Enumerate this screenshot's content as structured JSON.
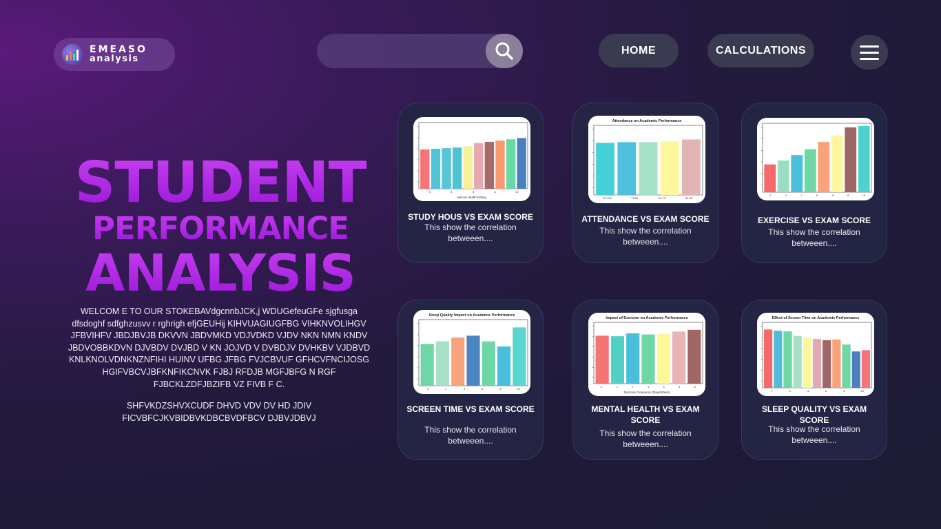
{
  "logo": {
    "line1": "EMEASO",
    "line2": "analysis",
    "icon": "bar-chart-logo-icon"
  },
  "search": {
    "placeholder": "",
    "icon": "search-icon"
  },
  "nav": {
    "home_label": "HOME",
    "calculations_label": "CALCULATIONS",
    "menu_icon": "hamburger-menu-icon"
  },
  "hero": {
    "line1": "STUDENT",
    "line2": "PERFORMANCE",
    "line3": "ANALYSIS"
  },
  "intro": {
    "paragraph1": "WELCOM E TO OUR STOKEBAVdgcnnbJCK,j WDUGefeuGFe sjgfusga dfsdoghf sdfghzusvv r rghrigh   efjGEUHij KIHVUAGIUGFBG VIHKNVOLIHGV JFBVIHFV JBDJBVJB DKVVN JBDVMKD VDJVDKD VJDV  NKN NMN  KNDV  JBDVOBBKDVN DJVBDV DVJBD V KN JOJVD V DVBDJV DVHKBV  VJDBVD  KNLKNOLVDNKNZNFIHI HUINV UFBG JFBG FVJCBVUF GFHCVFNCIJOSG HGIFVBCVJBFKNFIKCNVK FJBJ RFDJB MGFJBFG  N RGF  FJBCKLZDFJBZIFB VZ FIVB F C.",
    "paragraph2": "SHFVKDZSHVXCUDF DHVD VDV  DV HD JDIV FICVBFCJKVBIDBVKDBCBVDFBCV DJBVJDBVJ"
  },
  "cards": [
    {
      "title": "STUDY HOUS VS EXAM SCORE",
      "desc": "This show the correlation betweeen....",
      "chart_title": "",
      "chart_xlabel": "Mental Health Rating",
      "values": [
        0.62,
        0.63,
        0.64,
        0.65,
        0.67,
        0.72,
        0.74,
        0.76,
        0.78,
        0.8
      ],
      "colors": [
        "#f47575",
        "#4fc4d8",
        "#57c4d8",
        "#4fc3cf",
        "#f9f19a",
        "#e8a8b0",
        "#a56a6a",
        "#f79a72",
        "#6ad7a6",
        "#4b7fc0"
      ],
      "x_ticks": [
        "3",
        "4",
        "6",
        "8",
        "10"
      ]
    },
    {
      "title": "ATTENDANCE VS EXAM SCORE",
      "desc": "This show the correlation betweeen....",
      "chart_title": "Attendance on Academic Performance",
      "chart_xlabel": "",
      "values": [
        0.78,
        0.79,
        0.79,
        0.8,
        0.83
      ],
      "colors": [
        "#45d0d8",
        "#4fbfe0",
        "#a7e1c8",
        "#fdf69a",
        "#e3b4b4"
      ],
      "x_ticks": [
        "91-100",
        "71-80",
        "61-70",
        "51-60"
      ]
    },
    {
      "title": "EXERCISE VS EXAM SCORE",
      "desc": "This show the correlation betweeen....",
      "chart_title": "",
      "chart_xlabel": "",
      "values": [
        0.42,
        0.48,
        0.56,
        0.65,
        0.76,
        0.86,
        0.98,
        1.0
      ],
      "colors": [
        "#f46a6a",
        "#9bdcc2",
        "#49bfdc",
        "#6fd6a6",
        "#f9a27c",
        "#fdf6a0",
        "#a06666",
        "#4ed2d0"
      ],
      "x_ticks": [
        "0",
        "3",
        "7",
        "5",
        "4",
        "8",
        "10"
      ]
    },
    {
      "title": "SCREEN TIME VS EXAM SCORE",
      "desc": "This show the correlation betweeen....",
      "chart_title": "Sleep Quality Impact on Academic Performance",
      "chart_xlabel": "",
      "values": [
        0.66,
        0.7,
        0.76,
        0.79,
        0.7,
        0.62,
        0.92
      ],
      "colors": [
        "#6fd6a6",
        "#a8e0c6",
        "#f9a27c",
        "#4d85c0",
        "#6fd6a6",
        "#49bfdc",
        "#5ad6cf"
      ],
      "x_ticks": [
        "0",
        "2",
        "4",
        "6",
        "8",
        "10"
      ]
    },
    {
      "title": "MENTAL HEALTH VS EXAM SCORE",
      "desc": "This show the correlation betweeen....",
      "chart_title": "Impact of Exercise on Academic Performance",
      "chart_xlabel": "Exercise Frequency (Days/Week)",
      "values": [
        0.82,
        0.81,
        0.86,
        0.84,
        0.85,
        0.89,
        0.92
      ],
      "colors": [
        "#f47575",
        "#4fd2c4",
        "#49bfdc",
        "#6fd6a6",
        "#fdf69a",
        "#e8b4b8",
        "#a06666"
      ],
      "x_ticks": [
        "0",
        "1",
        "2",
        "3",
        "4",
        "5",
        "6"
      ]
    },
    {
      "title": "SLEEP QUALITY VS EXAM SCORE",
      "desc": "This show the correlation betweeen....",
      "chart_title": "Effect of Screen Time on Academic Performance",
      "chart_xlabel": "",
      "values": [
        0.93,
        0.91,
        0.9,
        0.83,
        0.8,
        0.78,
        0.76,
        0.77,
        0.69,
        0.58,
        0.6
      ],
      "colors": [
        "#f46a6a",
        "#4fbfd8",
        "#6fd6a6",
        "#a8e0c6",
        "#fdf69a",
        "#e3a8b4",
        "#a06666",
        "#f9a27c",
        "#6fd6a6",
        "#4d7fc0",
        "#f47575"
      ],
      "x_ticks": [
        "1",
        "3",
        "4",
        "6",
        "8",
        "10"
      ]
    }
  ],
  "colors": {
    "hero": "#b322e8",
    "card_bg": "#242544",
    "nav_button_bg": "#3a3a50"
  }
}
